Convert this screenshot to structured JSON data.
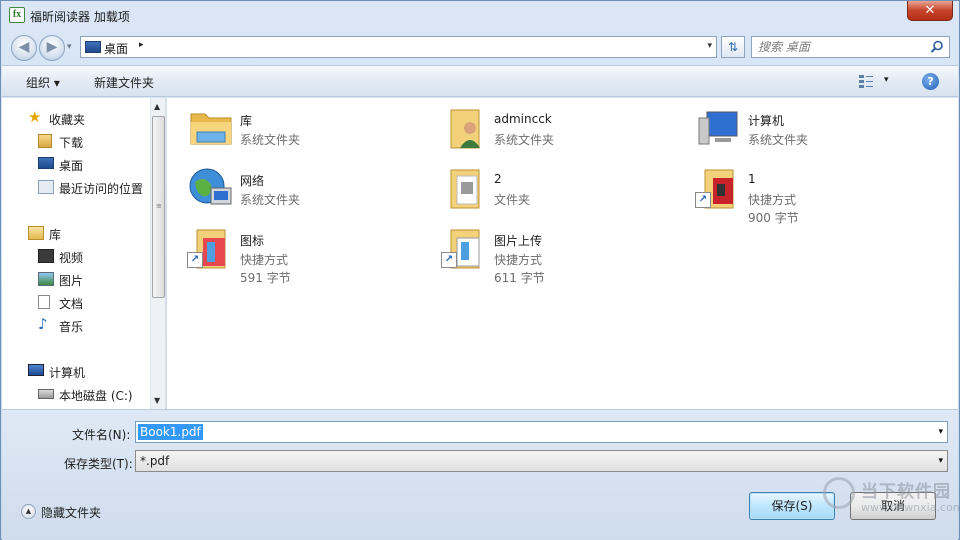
{
  "window": {
    "title": "福昕阅读器 加载项",
    "close_glyph": "✕"
  },
  "address_bar": {
    "location": "桌面",
    "arrow": "▸",
    "dropdown": "▾"
  },
  "search": {
    "placeholder": "搜索 桌面"
  },
  "toolbar": {
    "organize_label": "组织 ▾",
    "new_folder_label": "新建文件夹",
    "view_drop": "▾",
    "help": "?"
  },
  "nav_pane": {
    "favorites": {
      "label": "收藏夹",
      "items": [
        "下载",
        "桌面",
        "最近访问的位置"
      ]
    },
    "libraries": {
      "label": "库",
      "items": [
        "视频",
        "图片",
        "文档",
        "音乐"
      ]
    },
    "computer": {
      "label": "计算机",
      "items": [
        "本地磁盘 (C:)"
      ]
    }
  },
  "items": [
    {
      "name": "库",
      "line1": "系统文件夹",
      "line2": ""
    },
    {
      "name": "admincck",
      "line1": "系统文件夹",
      "line2": ""
    },
    {
      "name": "计算机",
      "line1": "系统文件夹",
      "line2": ""
    },
    {
      "name": "网络",
      "line1": "系统文件夹",
      "line2": ""
    },
    {
      "name": "2",
      "line1": "文件夹",
      "line2": ""
    },
    {
      "name": "1",
      "line1": "快捷方式",
      "line2": "900 字节"
    },
    {
      "name": "图标",
      "line1": "快捷方式",
      "line2": "591 字节"
    },
    {
      "name": "图片上传",
      "line1": "快捷方式",
      "line2": "611 字节"
    }
  ],
  "form": {
    "filename_label": "文件名(N):",
    "filename_value": "Book1.pdf",
    "type_label": "保存类型(T):",
    "type_value": "*.pdf"
  },
  "footer": {
    "hide_folders": "隐藏文件夹",
    "save_button": "保存(S)",
    "cancel_button": "取消"
  },
  "watermark": {
    "text": "当下软件园",
    "url": "www.downxia.com"
  }
}
